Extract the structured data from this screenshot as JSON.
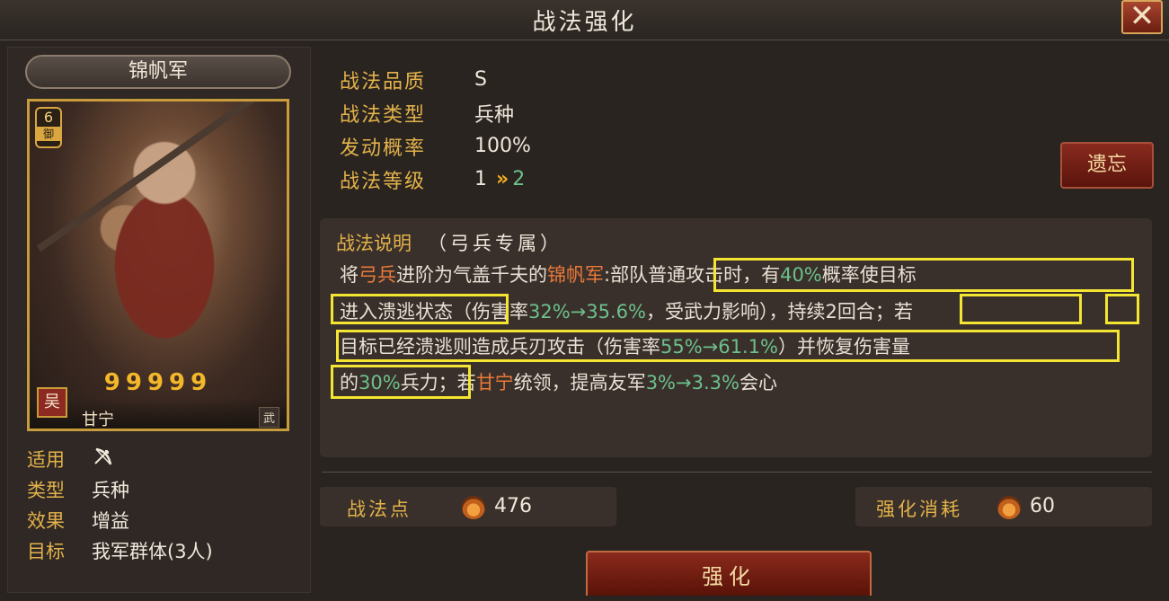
{
  "title": "战法强化",
  "close_label": "✕",
  "card": {
    "name_plate": "锦帆军",
    "cost": "6",
    "cost_type": "御",
    "stars": "99999",
    "faction": "吴",
    "general_name": "甘宁",
    "general_type": "武"
  },
  "attributes": [
    {
      "key": "适用",
      "value": "",
      "icon": "bow-icon"
    },
    {
      "key": "类型",
      "value": "兵种"
    },
    {
      "key": "效果",
      "value": "增益"
    },
    {
      "key": "目标",
      "value": "我军群体(3人)"
    }
  ],
  "info": {
    "quality_label": "战法品质",
    "quality": "S",
    "type_label": "战法类型",
    "type": "兵种",
    "rate_label": "发动概率",
    "rate": "100%",
    "level_label": "战法等级",
    "level_from": "1",
    "level_arrow": "»",
    "level_to": "2"
  },
  "forget_button": "遗忘",
  "description": {
    "heading": "战法说明",
    "subheading": "（弓兵专属）",
    "line1": {
      "a": "将",
      "b": "弓兵",
      "c": "进阶为气盖千夫的",
      "d": "锦帆军",
      "e": ":部队普通攻击时，有",
      "f": "40%",
      "g": "概率使目标"
    },
    "line2": {
      "a": "进入溃逃状态（伤害率",
      "b": "32%→35.6%",
      "c": "，受武力影响），持续2回合；若"
    },
    "line3": {
      "a": "目标已经溃逃则造成兵刃攻击（伤害率",
      "b": "55%→61.1%",
      "c": "）并恢复伤害量"
    },
    "line4": {
      "a": "的",
      "b": "30%",
      "c": "兵力；若",
      "d": "甘宁",
      "e": "统领，提高友军",
      "f": "3%→3.3%",
      "g": "会心"
    }
  },
  "points": {
    "label": "战法点",
    "value": "476"
  },
  "cost": {
    "label": "强化消耗",
    "value": "60"
  },
  "enhance_button": "强化",
  "colors": {
    "gold_label": "#e3b24a",
    "orange_highlight": "#ea7a3a",
    "green_value": "#6cc08c",
    "annotation_box": "#f4e532"
  }
}
